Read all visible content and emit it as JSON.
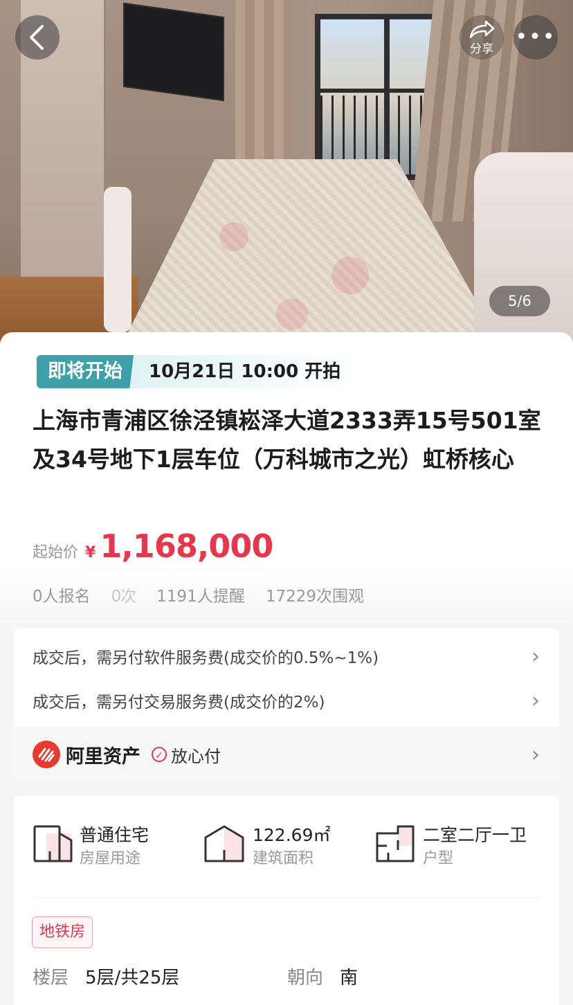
{
  "gallery": {
    "counter": "5/6"
  },
  "nav": {
    "share_label": "分享",
    "more_label": "•••"
  },
  "auction": {
    "status": "即将开始",
    "start_time": "10月21日  10:00  开拍",
    "title": "上海市青浦区徐泾镇崧泽大道2333弄15号501室及34号地下1层车位（万科城市之光）虹桥核心",
    "price_label": "起始价",
    "currency": "¥",
    "price": "1,168,000",
    "stats": {
      "signup": "0人报名",
      "partial": "0次",
      "reminders": "1191人提醒",
      "views": "17229次围观"
    }
  },
  "fees": {
    "software_fee": "成交后，需另付软件服务费(成交价的0.5%~1%)",
    "transaction_fee": "成交后，需另付交易服务费(成交价的2%)",
    "brand": "阿里资产",
    "safe_pay": "放心付"
  },
  "property": {
    "usage_value": "普通住宅",
    "usage_label": "房屋用途",
    "area_value": "122.69㎡",
    "area_label": "建筑面积",
    "layout_value": "二室二厅一卫",
    "layout_label": "户型",
    "tag": "地铁房",
    "floor_label": "楼层",
    "floor_value": "5层/共25层",
    "orientation_label": "朝向",
    "orientation_value": "南"
  },
  "colors": {
    "accent": "#e8364c",
    "status_teal": "#3ea0a8",
    "brand_red": "#e63a2e"
  }
}
